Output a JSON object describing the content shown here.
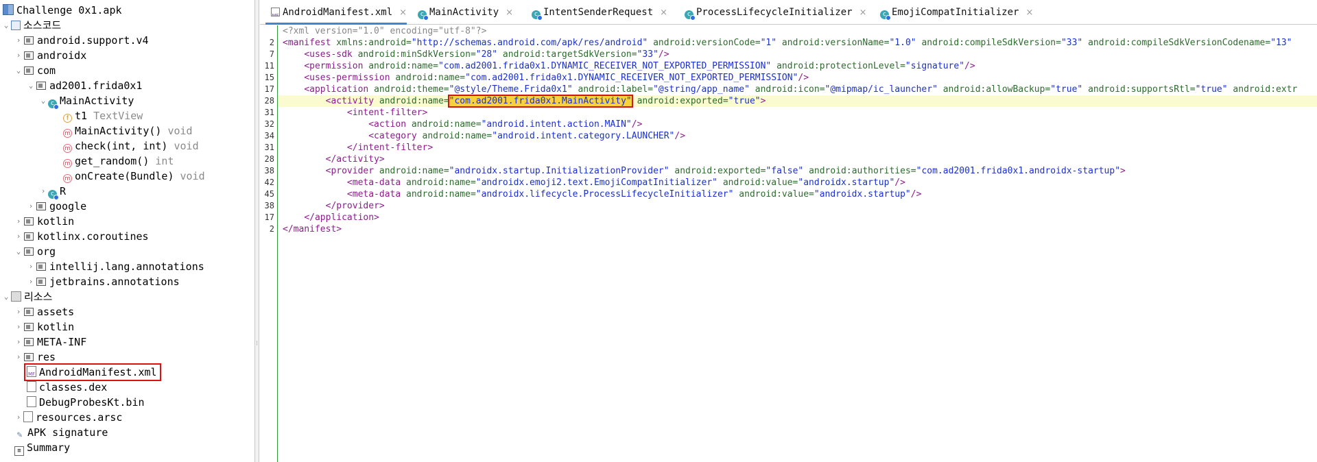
{
  "tree": {
    "root": "Challenge 0x1.apk",
    "source_code": "소스코드",
    "pkg_support_v4": "android.support.v4",
    "pkg_androidx": "androidx",
    "pkg_com": "com",
    "pkg_ad2001": "ad2001.frida0x1",
    "cls_main": "MainActivity",
    "field_t1": "t1",
    "field_t1_type": "TextView",
    "m_ctor": "MainActivity()",
    "m_ctor_type": "void",
    "m_check": "check(int, int)",
    "m_check_type": "void",
    "m_random": "get_random()",
    "m_random_type": "int",
    "m_oncreate": "onCreate(Bundle)",
    "m_oncreate_type": "void",
    "cls_r": "R",
    "pkg_google": "google",
    "pkg_kotlin": "kotlin",
    "pkg_coroutines": "kotlinx.coroutines",
    "pkg_org": "org",
    "pkg_intellij": "intellij.lang.annotations",
    "pkg_jetbrains": "jetbrains.annotations",
    "resources": "리소스",
    "res_assets": "assets",
    "res_kotlin": "kotlin",
    "res_metainf": "META-INF",
    "res_res": "res",
    "res_manifest": "AndroidManifest.xml",
    "res_dex": "classes.dex",
    "res_debugprobes": "DebugProbesKt.bin",
    "res_arsc": "resources.arsc",
    "apk_signature": "APK signature",
    "summary": "Summary",
    "file_icon_text": "MF"
  },
  "tabs": [
    {
      "label": "AndroidManifest.xml"
    },
    {
      "label": "MainActivity"
    },
    {
      "label": "IntentSenderRequest"
    },
    {
      "label": "ProcessLifecycleInitializer"
    },
    {
      "label": "EmojiCompatInitializer"
    }
  ],
  "close_glyph": "×",
  "editor": {
    "line_numbers": [
      "",
      "2",
      "7",
      "11",
      "15",
      "17",
      "28",
      "31",
      "32",
      "34",
      "31",
      "28",
      "38",
      "42",
      "45",
      "38",
      "17",
      "2"
    ],
    "l0": "<?xml version=\"1.0\" encoding=\"utf-8\"?>",
    "l1_tag": "<manifest",
    "l1_a1": "xmlns:android=",
    "l1_v1": "\"http://schemas.android.com/apk/res/android\"",
    "l1_a2": "android:versionCode=",
    "l1_v2": "\"1\"",
    "l1_a3": "android:versionName=",
    "l1_v3": "\"1.0\"",
    "l1_a4": "android:compileSdkVersion=",
    "l1_v4": "\"33\"",
    "l1_a5": "android:compileSdkVersionCodename=",
    "l1_v5": "\"13\"",
    "l2_tag": "<uses-sdk",
    "l2_a1": "android:minSdkVersion=",
    "l2_v1": "\"28\"",
    "l2_a2": "android:targetSdkVersion=",
    "l2_v2": "\"33\"",
    "l2_end": "/>",
    "l3_tag": "<permission",
    "l3_a1": "android:name=",
    "l3_v1": "\"com.ad2001.frida0x1.DYNAMIC_RECEIVER_NOT_EXPORTED_PERMISSION\"",
    "l3_a2": "android:protectionLevel=",
    "l3_v2": "\"signature\"",
    "l3_end": "/>",
    "l4_tag": "<uses-permission",
    "l4_a1": "android:name=",
    "l4_v1": "\"com.ad2001.frida0x1.DYNAMIC_RECEIVER_NOT_EXPORTED_PERMISSION\"",
    "l4_end": "/>",
    "l5_tag": "<application",
    "l5_a1": "android:theme=",
    "l5_v1": "\"@style/Theme.Frida0x1\"",
    "l5_a2": "android:label=",
    "l5_v2": "\"@string/app_name\"",
    "l5_a3": "android:icon=",
    "l5_v3": "\"@mipmap/ic_launcher\"",
    "l5_a4": "android:allowBackup=",
    "l5_v4": "\"true\"",
    "l5_a5": "android:supportsRtl=",
    "l5_v5": "\"true\"",
    "l5_a6": "android:extr",
    "l6_tag": "<activity",
    "l6_a1": "android:name=",
    "l6_v1": "\"com.ad2001.frida0x1.MainActivity\"",
    "l6_a2": "android:exported=",
    "l6_v2": "\"true\"",
    "l6_end": ">",
    "l7_tag": "<intent-filter>",
    "l8_tag": "<action",
    "l8_a1": "android:name=",
    "l8_v1": "\"android.intent.action.MAIN\"",
    "l8_end": "/>",
    "l9_tag": "<category",
    "l9_a1": "android:name=",
    "l9_v1": "\"android.intent.category.LAUNCHER\"",
    "l9_end": "/>",
    "l10_tag": "</intent-filter>",
    "l11_tag": "</activity>",
    "l12_tag": "<provider",
    "l12_a1": "android:name=",
    "l12_v1": "\"androidx.startup.InitializationProvider\"",
    "l12_a2": "android:exported=",
    "l12_v2": "\"false\"",
    "l12_a3": "android:authorities=",
    "l12_v3": "\"com.ad2001.frida0x1.androidx-startup\"",
    "l12_end": ">",
    "l13_tag": "<meta-data",
    "l13_a1": "android:name=",
    "l13_v1": "\"androidx.emoji2.text.EmojiCompatInitializer\"",
    "l13_a2": "android:value=",
    "l13_v2": "\"androidx.startup\"",
    "l13_end": "/>",
    "l14_tag": "<meta-data",
    "l14_a1": "android:name=",
    "l14_v1": "\"androidx.lifecycle.ProcessLifecycleInitializer\"",
    "l14_a2": "android:value=",
    "l14_v2": "\"androidx.startup\"",
    "l14_end": "/>",
    "l15_tag": "</provider>",
    "l16_tag": "</application>",
    "l17_tag": "</manifest>"
  }
}
